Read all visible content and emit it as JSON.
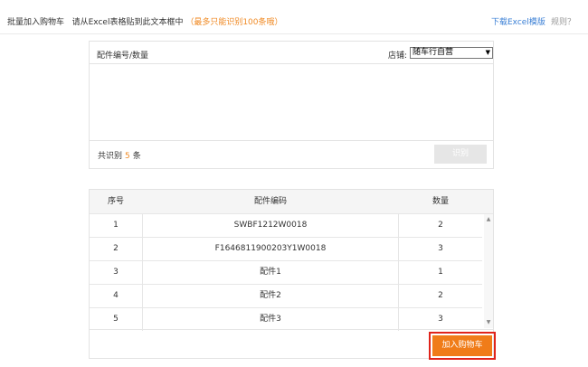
{
  "topbar": {
    "title": "批量加入购物车",
    "instruction": "请从Excel表格贴到此文本框中",
    "hint": "（最多只能识别100条哦）",
    "download_link": "下载Excel模版",
    "rules_link": "规则？"
  },
  "input_panel": {
    "header_label": "配件编号/数量",
    "store_label": "店铺:",
    "store_selected": "随车行自营",
    "count_prefix": "共识别",
    "count_value": "5",
    "count_suffix": "条",
    "recognize_button": "识别"
  },
  "table": {
    "headers": [
      "序号",
      "配件编码",
      "数量"
    ],
    "rows": [
      {
        "index": "1",
        "code": "SWBF1212W0018",
        "qty": "2"
      },
      {
        "index": "2",
        "code": "F1646811900203Y1W0018",
        "qty": "3"
      },
      {
        "index": "3",
        "code": "配件1",
        "qty": "1"
      },
      {
        "index": "4",
        "code": "配件2",
        "qty": "2"
      },
      {
        "index": "5",
        "code": "配件3",
        "qty": "3"
      }
    ]
  },
  "actions": {
    "add_to_cart": "加入购物车"
  },
  "colors": {
    "accent_orange": "#f07c19",
    "link_blue": "#3a7fd5",
    "highlight_red": "#e0241b"
  }
}
